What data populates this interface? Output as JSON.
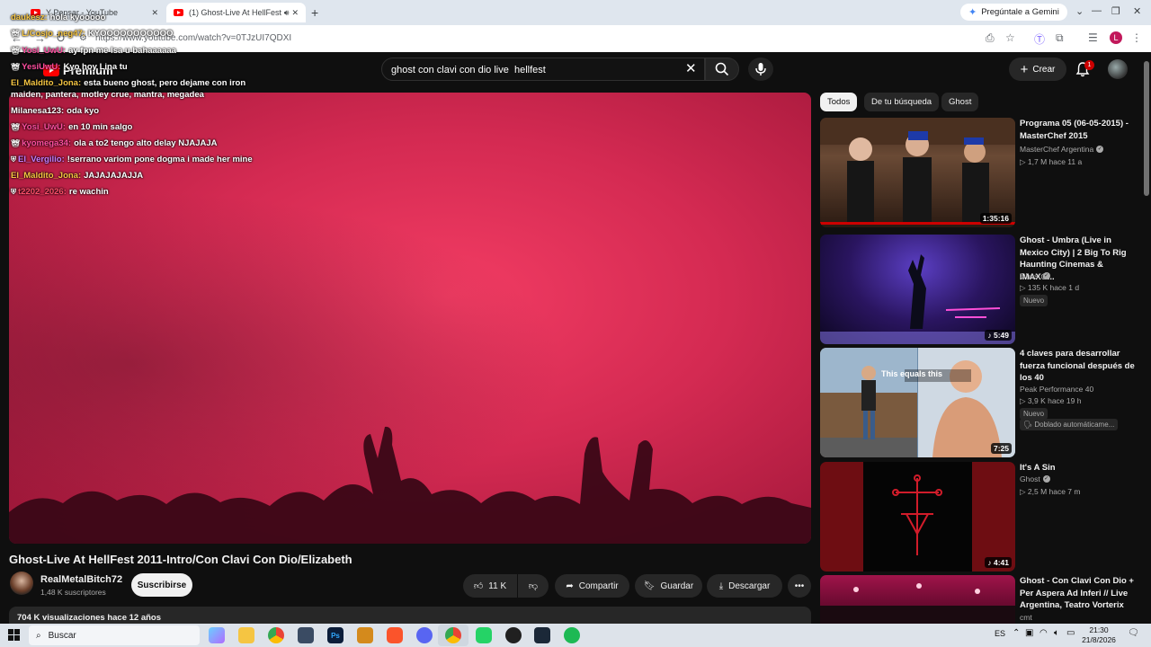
{
  "browser": {
    "tabs": [
      {
        "title": "Y Pensar - YouTube",
        "active": false
      },
      {
        "title": "(1) Ghost-Live At HellFest 2",
        "active": true
      }
    ],
    "gemini_label": "Pregúntale a Gemini",
    "url": "https://www.youtube.com/watch?v=0TJzUI7QDXI",
    "profile_initial": "L"
  },
  "yt_header": {
    "logo_text": "Premium",
    "search_value": "ghost con clavi con dio live  hellfest",
    "create_label": "Crear",
    "notifications_count": "1"
  },
  "chat": [
    {
      "user": "daukesz:",
      "text": "hola kyooooo",
      "user_color": "#f5c542"
    },
    {
      "user": "L/Cosjo_neg47:",
      "text": "KYOOOOOOOOOOO",
      "user_color": "#f5c542"
    },
    {
      "user": "Yosi_UwU:",
      "text": "ay fpn me lsa u bahaaaaaa",
      "user_color": "#ff4fa0"
    },
    {
      "user": "YesiUwU:",
      "text": "Kyo hoy Lina tu",
      "user_color": "#ff4fa0"
    },
    {
      "user": "El_Maldito_Jona:",
      "text": "esta bueno ghost, pero dejame con iron",
      "user_color": "#f5c542"
    },
    {
      "user": "",
      "text": "maiden, pantera, motley crue, mantra, megadea",
      "user_color": "#ffffff"
    },
    {
      "user": "Milanesa123:",
      "text": "oda kyo",
      "user_color": "#ffffff"
    },
    {
      "user": "Yosi_UwU:",
      "text": "en 10 min salgo",
      "user_color": "#ff4fa0"
    },
    {
      "user": "kyomega34:",
      "text": "ola a to2 tengo alto delay NJAJAJA",
      "user_color": "#ff4fa0"
    },
    {
      "user": "El_Vergilio:",
      "text": "!serrano variom pone dogma i made her mine",
      "user_color": "#c77dff"
    },
    {
      "user": "El_Maldito_Jona:",
      "text": "JAJAJAJAJJA",
      "user_color": "#f5c542"
    },
    {
      "user": "t2202_2026:",
      "text": "re wachin",
      "user_color": "#ff4f6a"
    }
  ],
  "video": {
    "title": "Ghost-Live At HellFest 2011-Intro/Con Clavi Con Dio/Elizabeth",
    "channel": "RealMetalBitch72",
    "subscribers": "1,48 K suscriptores",
    "subscribe_label": "Suscribirse",
    "likes": "11 K",
    "share_label": "Compartir",
    "save_label": "Guardar",
    "download_label": "Descargar",
    "views": "704 K visualizaciones  hace 12 años"
  },
  "filters": [
    "Todos",
    "De tu búsqueda",
    "Ghost"
  ],
  "recommendations": [
    {
      "title": "Programa 05 (06-05-2015) - MasterChef 2015",
      "channel": "MasterChef Argentina",
      "verified": true,
      "meta": "▷ 1,7 M   hace 11 a",
      "duration": "1:35:16",
      "badges": []
    },
    {
      "title": "Ghost - Umbra (Live in Mexico City) | 2 Big To Rig Haunting Cinemas & IMAX®...",
      "channel": "Ghost",
      "verified": true,
      "meta": "▷ 135 K   hace 1 d",
      "duration": "5:49",
      "badges": [
        "Nuevo"
      ]
    },
    {
      "title": "4 claves para desarrollar fuerza funcional después de los 40",
      "channel": "Peak Performance 40",
      "verified": false,
      "meta": "▷ 3,9 K   hace 19 h",
      "duration": "7:25",
      "badges": [
        "Nuevo",
        "Doblado automáticame..."
      ],
      "thumb_text": "This equals this"
    },
    {
      "title": "It's A Sin",
      "channel": "Ghost",
      "verified": true,
      "meta": "▷ 2,5 M   hace 7 m",
      "duration": "4:41",
      "badges": []
    },
    {
      "title": "Ghost - Con Clavi Con Dio + Per Aspera Ad Inferi // Live Argentina, Teatro Vorterix",
      "channel": "cmt",
      "verified": false,
      "meta": "",
      "duration": "",
      "badges": []
    }
  ],
  "taskbar": {
    "search_label": "Buscar",
    "language": "ES",
    "time": "21:30",
    "date": "21/8/2026"
  },
  "colors": {
    "accent": "#ff0000",
    "player_red": "#e0315a"
  }
}
